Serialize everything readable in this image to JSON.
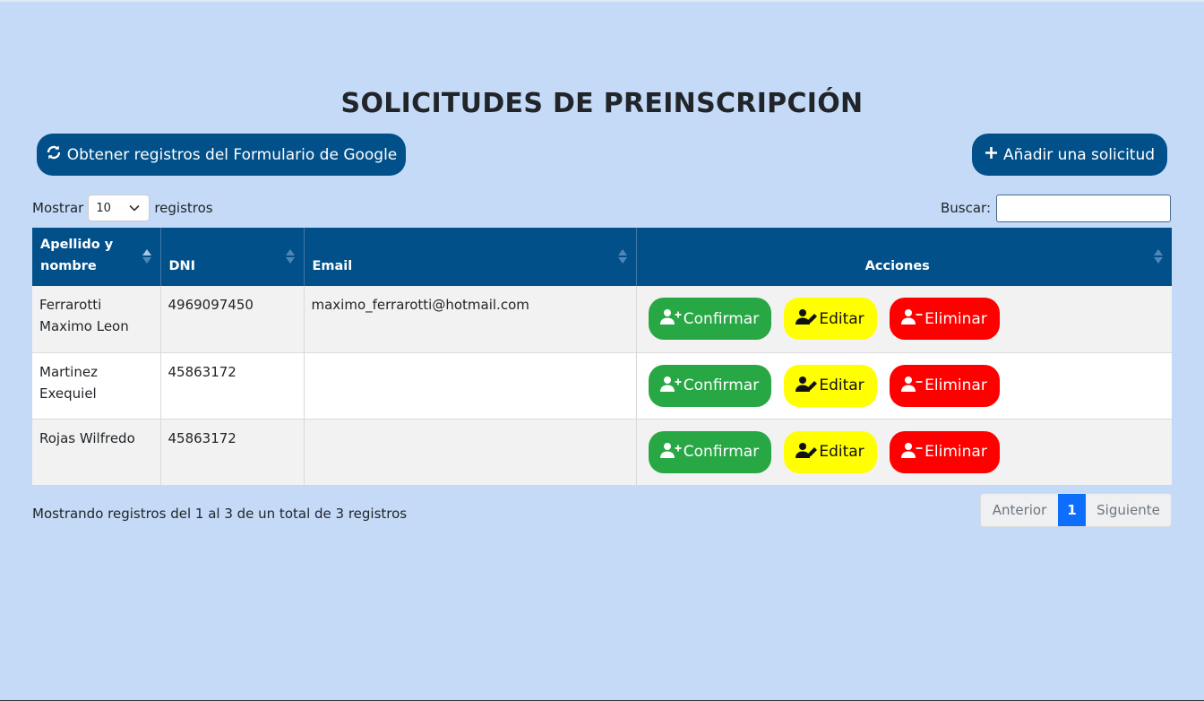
{
  "page_title": "SOLICITUDES DE PREINSCRIPCIÓN",
  "toolbar": {
    "google_button_label": "Obtener registros del Formulario de Google",
    "add_button_label": "Añadir una solicitud"
  },
  "length_control": {
    "prefix": "Mostrar",
    "selected": "10",
    "suffix": "registros"
  },
  "search": {
    "label": "Buscar:",
    "value": ""
  },
  "table": {
    "columns": [
      "Apellido y nombre",
      "DNI",
      "Email",
      "Acciones"
    ],
    "rows": [
      {
        "name": "Ferrarotti Maximo Leon",
        "dni": "4969097450",
        "email": "maximo_ferrarotti@hotmail.com"
      },
      {
        "name": "Martinez Exequiel",
        "dni": "45863172",
        "email": ""
      },
      {
        "name": "Rojas Wilfredo",
        "dni": "45863172",
        "email": ""
      }
    ],
    "actions": {
      "confirm": "Confirmar",
      "edit": "Editar",
      "delete": "Eliminar"
    }
  },
  "footer": {
    "info": "Mostrando registros del 1 al 3 de un total de 3 registros",
    "pagination": {
      "previous": "Anterior",
      "current": "1",
      "next": "Siguiente"
    }
  },
  "colors": {
    "background": "#c4daf7",
    "primary": "#02508a",
    "confirm": "#28a745",
    "edit": "#ffff00",
    "delete": "#ff0000",
    "active_page": "#0d6efd"
  },
  "icons": {
    "google_button": "refresh-icon",
    "add_button": "plus-icon",
    "confirm": "user-plus-icon",
    "edit": "user-edit-icon",
    "delete": "user-minus-icon"
  }
}
